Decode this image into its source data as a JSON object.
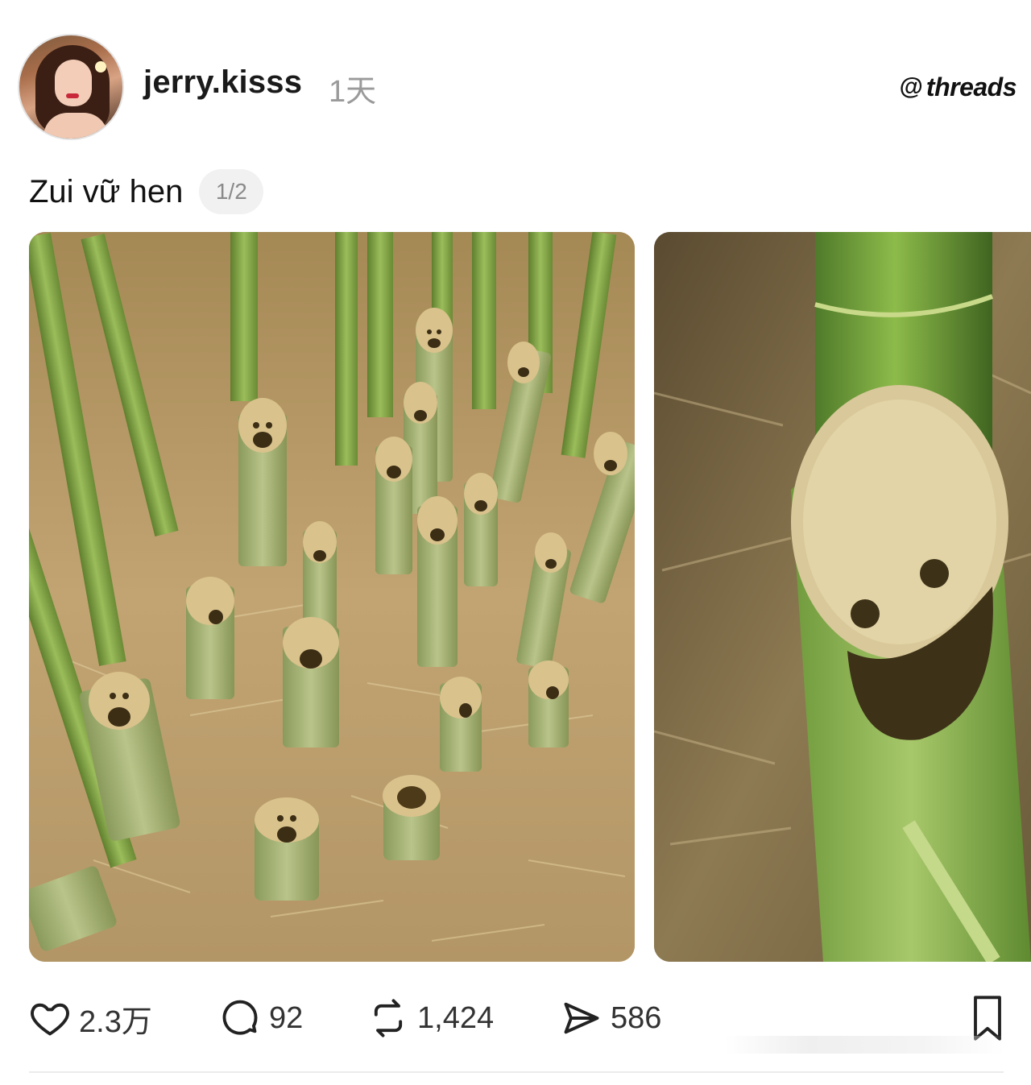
{
  "post": {
    "username": "jerry.kisss",
    "time": "1天",
    "caption": "Zui vữ hen",
    "page_indicator": "1/2"
  },
  "brand": {
    "icon": "@",
    "name": "threads"
  },
  "media": {
    "photos": [
      {
        "description": "bamboo-faces-grove"
      },
      {
        "description": "bamboo-face-closeup"
      }
    ]
  },
  "actions": {
    "likes": "2.3万",
    "comments": "92",
    "reposts": "1,424",
    "shares": "586"
  },
  "icons": {
    "like": "heart-icon",
    "comment": "comment-bubble-icon",
    "repost": "repost-icon",
    "share": "send-icon",
    "bookmark": "bookmark-icon"
  },
  "colors": {
    "text": "#111111",
    "muted": "#9a9a9a",
    "pill_bg": "#f1f1f1",
    "bamboo": "#7fa046"
  }
}
